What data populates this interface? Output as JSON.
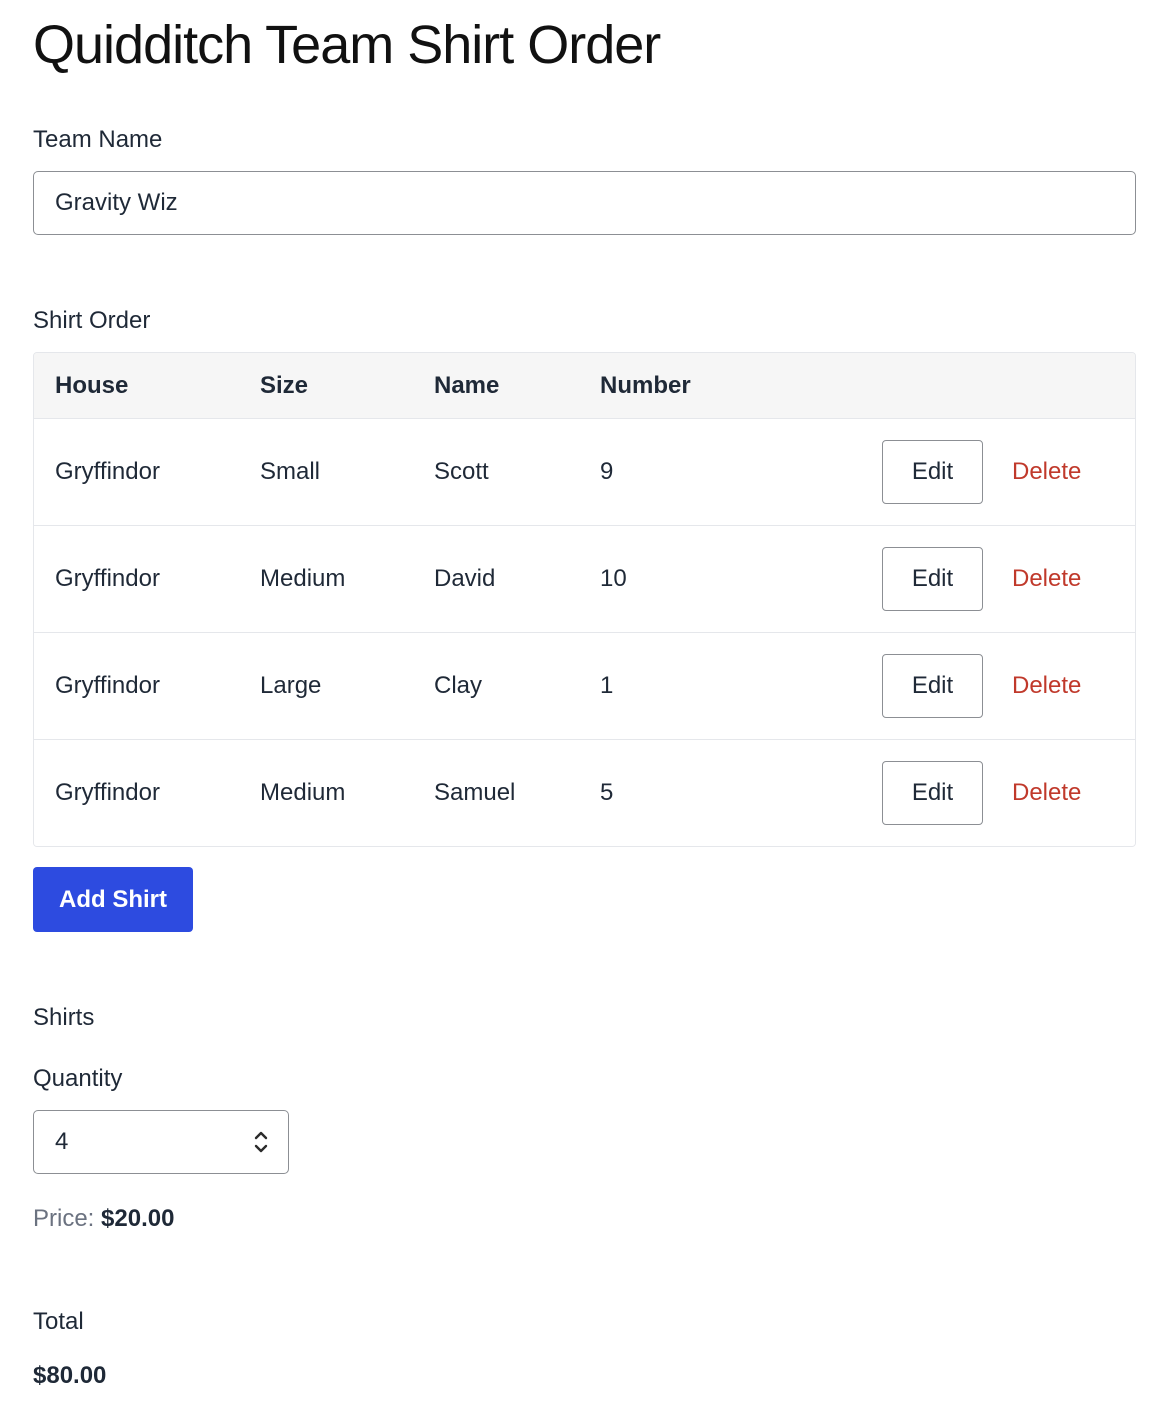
{
  "page": {
    "title": "Quidditch Team Shirt Order"
  },
  "team_name": {
    "label": "Team Name",
    "value": "Gravity Wiz"
  },
  "shirt_order": {
    "label": "Shirt Order",
    "columns": [
      "House",
      "Size",
      "Name",
      "Number"
    ],
    "rows": [
      {
        "house": "Gryffindor",
        "size": "Small",
        "name": "Scott",
        "number": "9",
        "edit_label": "Edit",
        "delete_label": "Delete"
      },
      {
        "house": "Gryffindor",
        "size": "Medium",
        "name": "David",
        "number": "10",
        "edit_label": "Edit",
        "delete_label": "Delete"
      },
      {
        "house": "Gryffindor",
        "size": "Large",
        "name": "Clay",
        "number": "1",
        "edit_label": "Edit",
        "delete_label": "Delete"
      },
      {
        "house": "Gryffindor",
        "size": "Medium",
        "name": "Samuel",
        "number": "5",
        "edit_label": "Edit",
        "delete_label": "Delete"
      }
    ],
    "add_button_label": "Add Shirt"
  },
  "shirts": {
    "label": "Shirts",
    "quantity_label": "Quantity",
    "quantity_value": "4",
    "price_label": "Price:",
    "price_value": "$20.00"
  },
  "total": {
    "label": "Total",
    "value": "$80.00"
  },
  "colors": {
    "primary_button": "#2d4be0",
    "delete_link": "#c0392b",
    "border": "#8c8f94",
    "table_header_bg": "#f6f6f6"
  },
  "icons": {
    "stepper": "chevron-up-down-icon"
  }
}
